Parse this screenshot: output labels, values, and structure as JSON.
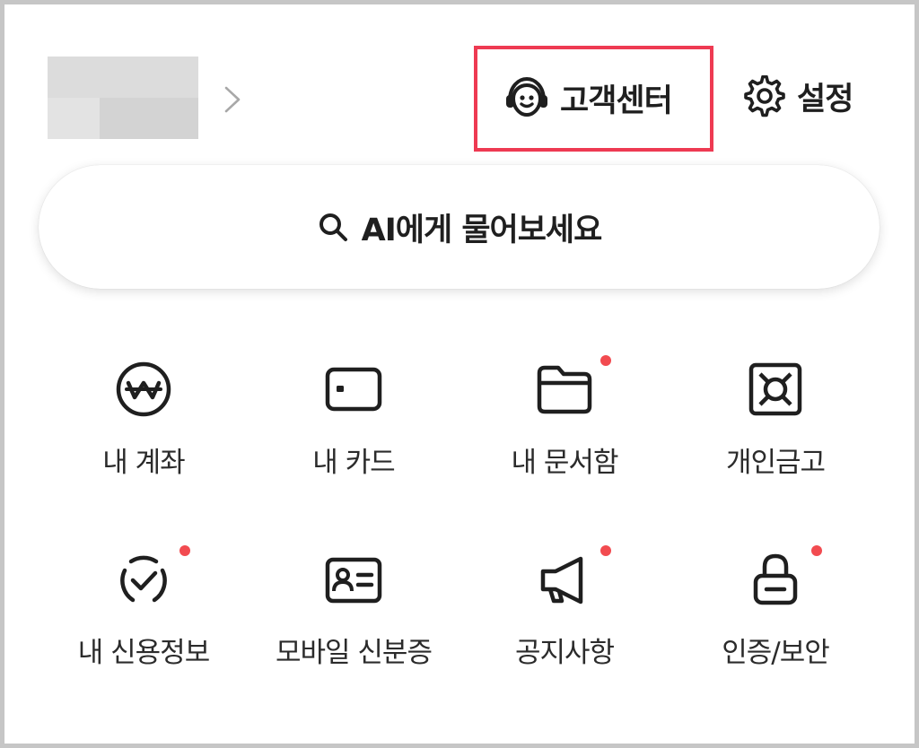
{
  "header": {
    "customer_center_label": "고객센터",
    "settings_label": "설정"
  },
  "search": {
    "label": "AI에게 물어보세요"
  },
  "colors": {
    "highlight_border": "#ee3a52",
    "notification_dot": "#f24b50",
    "text": "#1f1f1f"
  },
  "menu": [
    {
      "label": "내 계좌",
      "icon": "won-coin-icon",
      "badge": false
    },
    {
      "label": "내 카드",
      "icon": "card-icon",
      "badge": false
    },
    {
      "label": "내 문서함",
      "icon": "folder-icon",
      "badge": true
    },
    {
      "label": "개인금고",
      "icon": "safe-icon",
      "badge": false
    },
    {
      "label": "내 신용정보",
      "icon": "credit-check-icon",
      "badge": true
    },
    {
      "label": "모바일 신분증",
      "icon": "id-card-icon",
      "badge": false
    },
    {
      "label": "공지사항",
      "icon": "megaphone-icon",
      "badge": true
    },
    {
      "label": "인증/보안",
      "icon": "lock-icon",
      "badge": true
    }
  ]
}
